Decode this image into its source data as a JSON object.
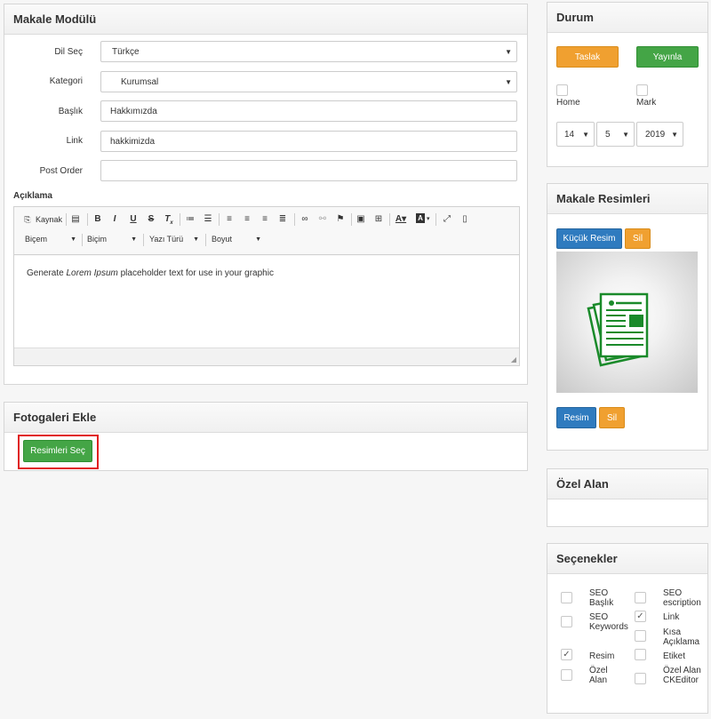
{
  "article": {
    "title": "Makale Modülü",
    "fields": {
      "lang_label": "Dil Seç",
      "lang_value": "Türkçe",
      "category_label": "Kategori",
      "category_value": "Kurumsal",
      "title_label": "Başlık",
      "title_value": "Hakkımızda",
      "link_label": "Link",
      "link_value": "hakkimizda",
      "post_order_label": "Post Order",
      "post_order_value": "",
      "description_label": "Açıklama"
    },
    "editor": {
      "source_label": "Kaynak",
      "combos": [
        "Biçem",
        "Biçim",
        "Yazı Türü",
        "Boyut"
      ],
      "content_prefix": "Generate ",
      "content_italic": "Lorem Ipsum",
      "content_suffix": " placeholder text for use in your graphic"
    }
  },
  "gallery": {
    "title": "Fotogaleri Ekle",
    "select_button": "Resimleri Seç"
  },
  "status": {
    "title": "Durum",
    "draft_button": "Taslak",
    "publish_button": "Yayınla",
    "home_label": "Home",
    "mark_label": "Mark",
    "day": "14",
    "month": "5",
    "year": "2019"
  },
  "images": {
    "title": "Makale Resimleri",
    "small_image_button": "Küçük Resim",
    "delete_button": "Sil",
    "image_button": "Resim",
    "delete_button2": "Sil"
  },
  "custom": {
    "title": "Özel Alan"
  },
  "options": {
    "title": "Seçenekler",
    "items": [
      {
        "label": "SEO Başlık",
        "checked": false
      },
      {
        "label": "SEO escription",
        "checked": false
      },
      {
        "label": "SEO Keywords",
        "checked": false
      },
      {
        "label": "Link",
        "checked": true
      },
      {
        "label": "Kısa Açıklama",
        "checked": false
      },
      {
        "label": "Resim",
        "checked": true
      },
      {
        "label": "Etiket",
        "checked": false
      },
      {
        "label": "Özel Alan",
        "checked": false
      },
      {
        "label": "Özel Alan CKEditor",
        "checked": false
      }
    ]
  },
  "colors": {
    "orange": "#f0a030",
    "green": "#44a546",
    "blue": "#2f7bbf",
    "highlight_red": "#e02020"
  }
}
